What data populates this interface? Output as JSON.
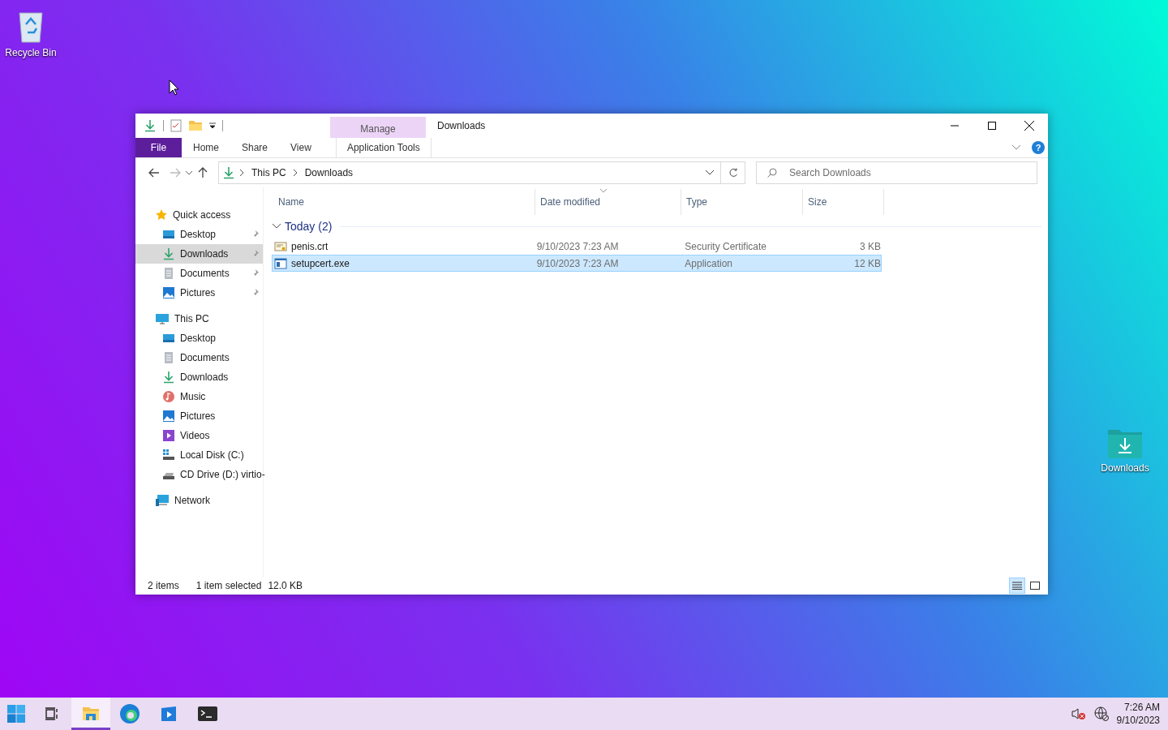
{
  "desktop_icons": [
    {
      "kind": "recycle_bin",
      "label": "Recycle Bin"
    },
    {
      "kind": "downloads_folder",
      "label": "Downloads"
    }
  ],
  "window": {
    "title": "Downloads",
    "contextual_header": "Manage",
    "ribbon_tabs": [
      {
        "kind": "file",
        "label": "File"
      },
      {
        "kind": "tab",
        "label": "Home"
      },
      {
        "kind": "tab",
        "label": "Share"
      },
      {
        "kind": "tab",
        "label": "View"
      },
      {
        "kind": "contextual",
        "label": "Application Tools"
      }
    ],
    "help": "?",
    "breadcrumb": [
      "This PC",
      "Downloads"
    ],
    "search": {
      "placeholder": "Search Downloads"
    },
    "nav": [
      {
        "kind": "star",
        "label": "Quick access",
        "pinned": false,
        "selected": false,
        "children": [
          {
            "kind": "desktop",
            "label": "Desktop",
            "pinned": true,
            "selected": false
          },
          {
            "kind": "download",
            "label": "Downloads",
            "pinned": true,
            "selected": true
          },
          {
            "kind": "document",
            "label": "Documents",
            "pinned": true,
            "selected": false
          },
          {
            "kind": "picture",
            "label": "Pictures",
            "pinned": true,
            "selected": false
          }
        ]
      },
      {
        "kind": "pc",
        "label": "This PC",
        "pinned": false,
        "selected": false,
        "children": [
          {
            "kind": "desktop",
            "label": "Desktop",
            "pinned": false,
            "selected": false
          },
          {
            "kind": "document",
            "label": "Documents",
            "pinned": false,
            "selected": false
          },
          {
            "kind": "download",
            "label": "Downloads",
            "pinned": false,
            "selected": false
          },
          {
            "kind": "music",
            "label": "Music",
            "pinned": false,
            "selected": false
          },
          {
            "kind": "picture",
            "label": "Pictures",
            "pinned": false,
            "selected": false
          },
          {
            "kind": "video",
            "label": "Videos",
            "pinned": false,
            "selected": false
          },
          {
            "kind": "disk",
            "label": "Local Disk (C:)",
            "pinned": false,
            "selected": false
          },
          {
            "kind": "cd",
            "label": "CD Drive (D:) virtio-",
            "pinned": false,
            "selected": false
          }
        ]
      },
      {
        "kind": "network",
        "label": "Network",
        "pinned": false,
        "selected": false
      }
    ],
    "columns": [
      {
        "label": "Name",
        "sorted": false
      },
      {
        "label": "Date modified",
        "sorted": true
      },
      {
        "label": "Type",
        "sorted": false
      },
      {
        "label": "Size",
        "sorted": false
      }
    ],
    "group": {
      "label": "Today (2)",
      "expanded": true
    },
    "files": [
      {
        "kind": "certificate",
        "name": "penis.crt",
        "date": "9/10/2023 7:23 AM",
        "type": "Security Certificate",
        "size": "3 KB",
        "selected": false
      },
      {
        "kind": "application",
        "name": "setupcert.exe",
        "date": "9/10/2023 7:23 AM",
        "type": "Application",
        "size": "12 KB",
        "selected": true
      }
    ],
    "status_bar": {
      "count": "2 items",
      "selection": "1 item selected",
      "selection_size": "12.0 KB",
      "views": [
        {
          "kind": "details",
          "selected": true
        },
        {
          "kind": "large_icons",
          "selected": false
        }
      ]
    }
  },
  "taskbar": {
    "items": [
      {
        "kind": "start",
        "selected": false
      },
      {
        "kind": "task_view",
        "selected": false
      },
      {
        "kind": "explorer",
        "selected": true
      },
      {
        "kind": "edge",
        "selected": false
      },
      {
        "kind": "media",
        "selected": false
      },
      {
        "kind": "terminal",
        "selected": false
      }
    ],
    "clock": {
      "time": "7:26 AM",
      "date": "9/10/2023"
    }
  }
}
